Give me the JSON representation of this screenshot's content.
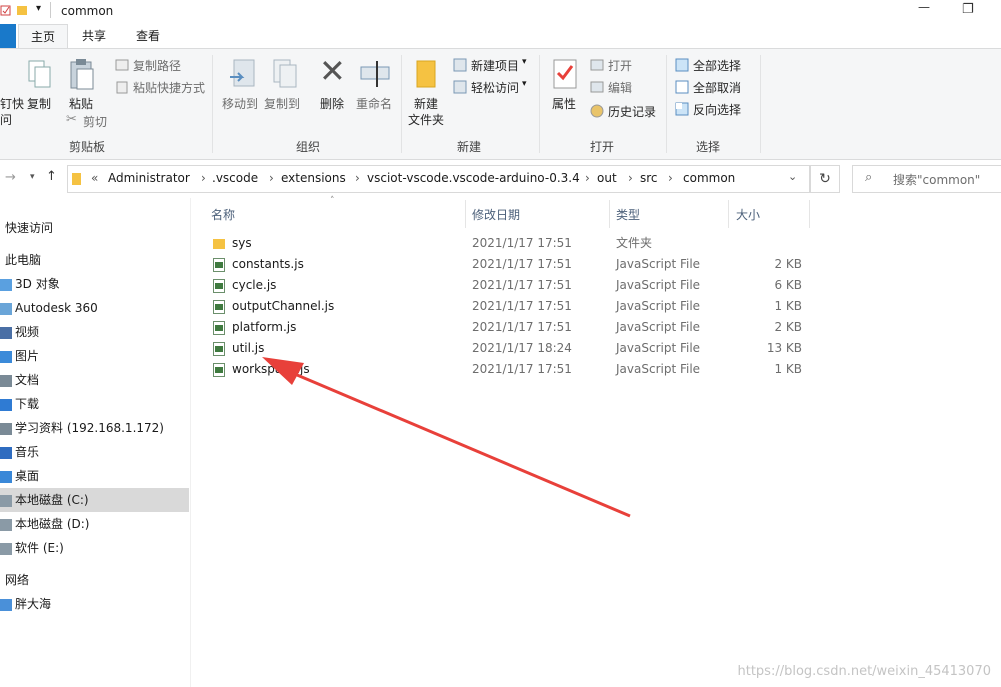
{
  "window": {
    "title": "common",
    "restore_glyph": "❐",
    "minimize_glyph": "—"
  },
  "ribbon": {
    "tabs": [
      "主页",
      "共享",
      "查看"
    ],
    "clipboard": {
      "pin_partial": "钉快",
      "pin_partial2": "问",
      "copy": "复制",
      "paste": "粘贴",
      "copy_path": "复制路径",
      "paste_shortcut": "粘贴快捷方式",
      "cut": "剪切",
      "group": "剪贴板"
    },
    "organize": {
      "move_to": "移动到",
      "copy_to": "复制到",
      "delete": "删除",
      "rename": "重命名",
      "group": "组织"
    },
    "new": {
      "new_folder_line1": "新建",
      "new_folder_line2": "文件夹",
      "new_item": "新建项目",
      "easy_access": "轻松访问",
      "group": "新建"
    },
    "open": {
      "properties": "属性",
      "open": "打开",
      "edit": "编辑",
      "history": "历史记录",
      "group": "打开"
    },
    "select": {
      "select_all": "全部选择",
      "select_none": "全部取消",
      "invert": "反向选择",
      "group": "选择"
    }
  },
  "address": {
    "overflow": "«",
    "crumbs": [
      "Administrator",
      ".vscode",
      "extensions",
      "vsciot-vscode.vscode-arduino-0.3.4",
      "out",
      "src",
      "common"
    ],
    "search_placeholder": "搜索\"common\""
  },
  "nav": {
    "items": [
      {
        "label": "快速访问",
        "icon": "star-icon"
      },
      {
        "label": "此电脑",
        "icon": "computer-icon"
      },
      {
        "label": "3D 对象",
        "icon": "cube-icon"
      },
      {
        "label": "Autodesk 360",
        "icon": "cloud-icon"
      },
      {
        "label": "视频",
        "icon": "video-icon"
      },
      {
        "label": "图片",
        "icon": "picture-icon"
      },
      {
        "label": "文档",
        "icon": "document-icon"
      },
      {
        "label": "下载",
        "icon": "download-icon"
      },
      {
        "label": "学习资料 (192.168.1.172)",
        "icon": "network-drive-icon"
      },
      {
        "label": "音乐",
        "icon": "music-icon"
      },
      {
        "label": "桌面",
        "icon": "desktop-icon"
      },
      {
        "label": "本地磁盘 (C:)",
        "icon": "drive-icon"
      },
      {
        "label": "本地磁盘 (D:)",
        "icon": "drive-icon"
      },
      {
        "label": "软件 (E:)",
        "icon": "drive-icon"
      },
      {
        "label": "网络",
        "icon": "network-icon"
      },
      {
        "label": "胖大海",
        "icon": "computer-icon"
      }
    ]
  },
  "files": {
    "columns": [
      "名称",
      "修改日期",
      "类型",
      "大小"
    ],
    "rows": [
      {
        "name": "sys",
        "date": "2021/1/17 17:51",
        "type": "文件夹",
        "size": "",
        "icon": "folder-icon"
      },
      {
        "name": "constants.js",
        "date": "2021/1/17 17:51",
        "type": "JavaScript File",
        "size": "2 KB",
        "icon": "js-file-icon"
      },
      {
        "name": "cycle.js",
        "date": "2021/1/17 17:51",
        "type": "JavaScript File",
        "size": "6 KB",
        "icon": "js-file-icon"
      },
      {
        "name": "outputChannel.js",
        "date": "2021/1/17 17:51",
        "type": "JavaScript File",
        "size": "1 KB",
        "icon": "js-file-icon"
      },
      {
        "name": "platform.js",
        "date": "2021/1/17 17:51",
        "type": "JavaScript File",
        "size": "2 KB",
        "icon": "js-file-icon"
      },
      {
        "name": "util.js",
        "date": "2021/1/17 18:24",
        "type": "JavaScript File",
        "size": "13 KB",
        "icon": "js-file-icon"
      },
      {
        "name": "workspace.js",
        "date": "2021/1/17 17:51",
        "type": "JavaScript File",
        "size": "1 KB",
        "icon": "js-file-icon"
      }
    ]
  },
  "watermark": "https://blog.csdn.net/weixin_45413070",
  "colors": {
    "accent": "#1979ca",
    "arrow": "#e8403a",
    "selected_nav": "#d9d9d9",
    "folder": "#f5c242"
  }
}
